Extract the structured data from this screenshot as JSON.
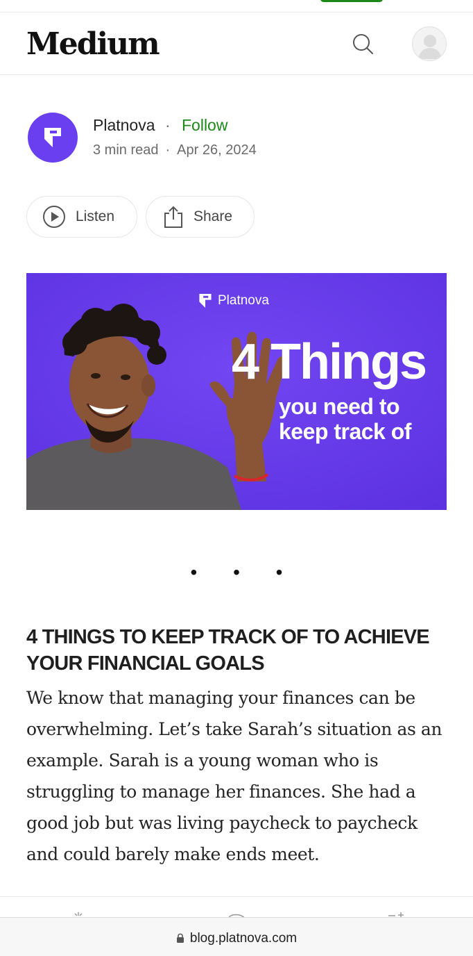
{
  "header": {
    "logo": "Medium",
    "search_icon": "search-icon",
    "avatar_icon": "user-avatar-icon"
  },
  "author": {
    "name": "Platnova",
    "separator": "·",
    "follow_label": "Follow",
    "read_time": "3 min read",
    "meta_separator": "·",
    "date": "Apr 26, 2024",
    "avatar_color": "#6a3ff0",
    "follow_color": "#1a8917"
  },
  "actions": {
    "listen_label": "Listen",
    "share_label": "Share"
  },
  "hero": {
    "brand": "Platnova",
    "title": "4 Things",
    "subtitle_line1": "you need to",
    "subtitle_line2": "keep track of",
    "background_color": "#6b3ded"
  },
  "article": {
    "section_break": "• • •",
    "heading": "4 THINGS TO KEEP TRACK OF TO ACHIEVE YOUR FINANCIAL GOALS",
    "paragraph": "We know that managing your finances can be overwhelming. Let’s take Sarah’s situation as an example. Sarah is a young woman who is struggling to manage her finances. She had a good job but was living paycheck to paycheck and could barely make ends meet."
  },
  "browser": {
    "url": "blog.platnova.com",
    "lock_icon": "lock-icon"
  }
}
